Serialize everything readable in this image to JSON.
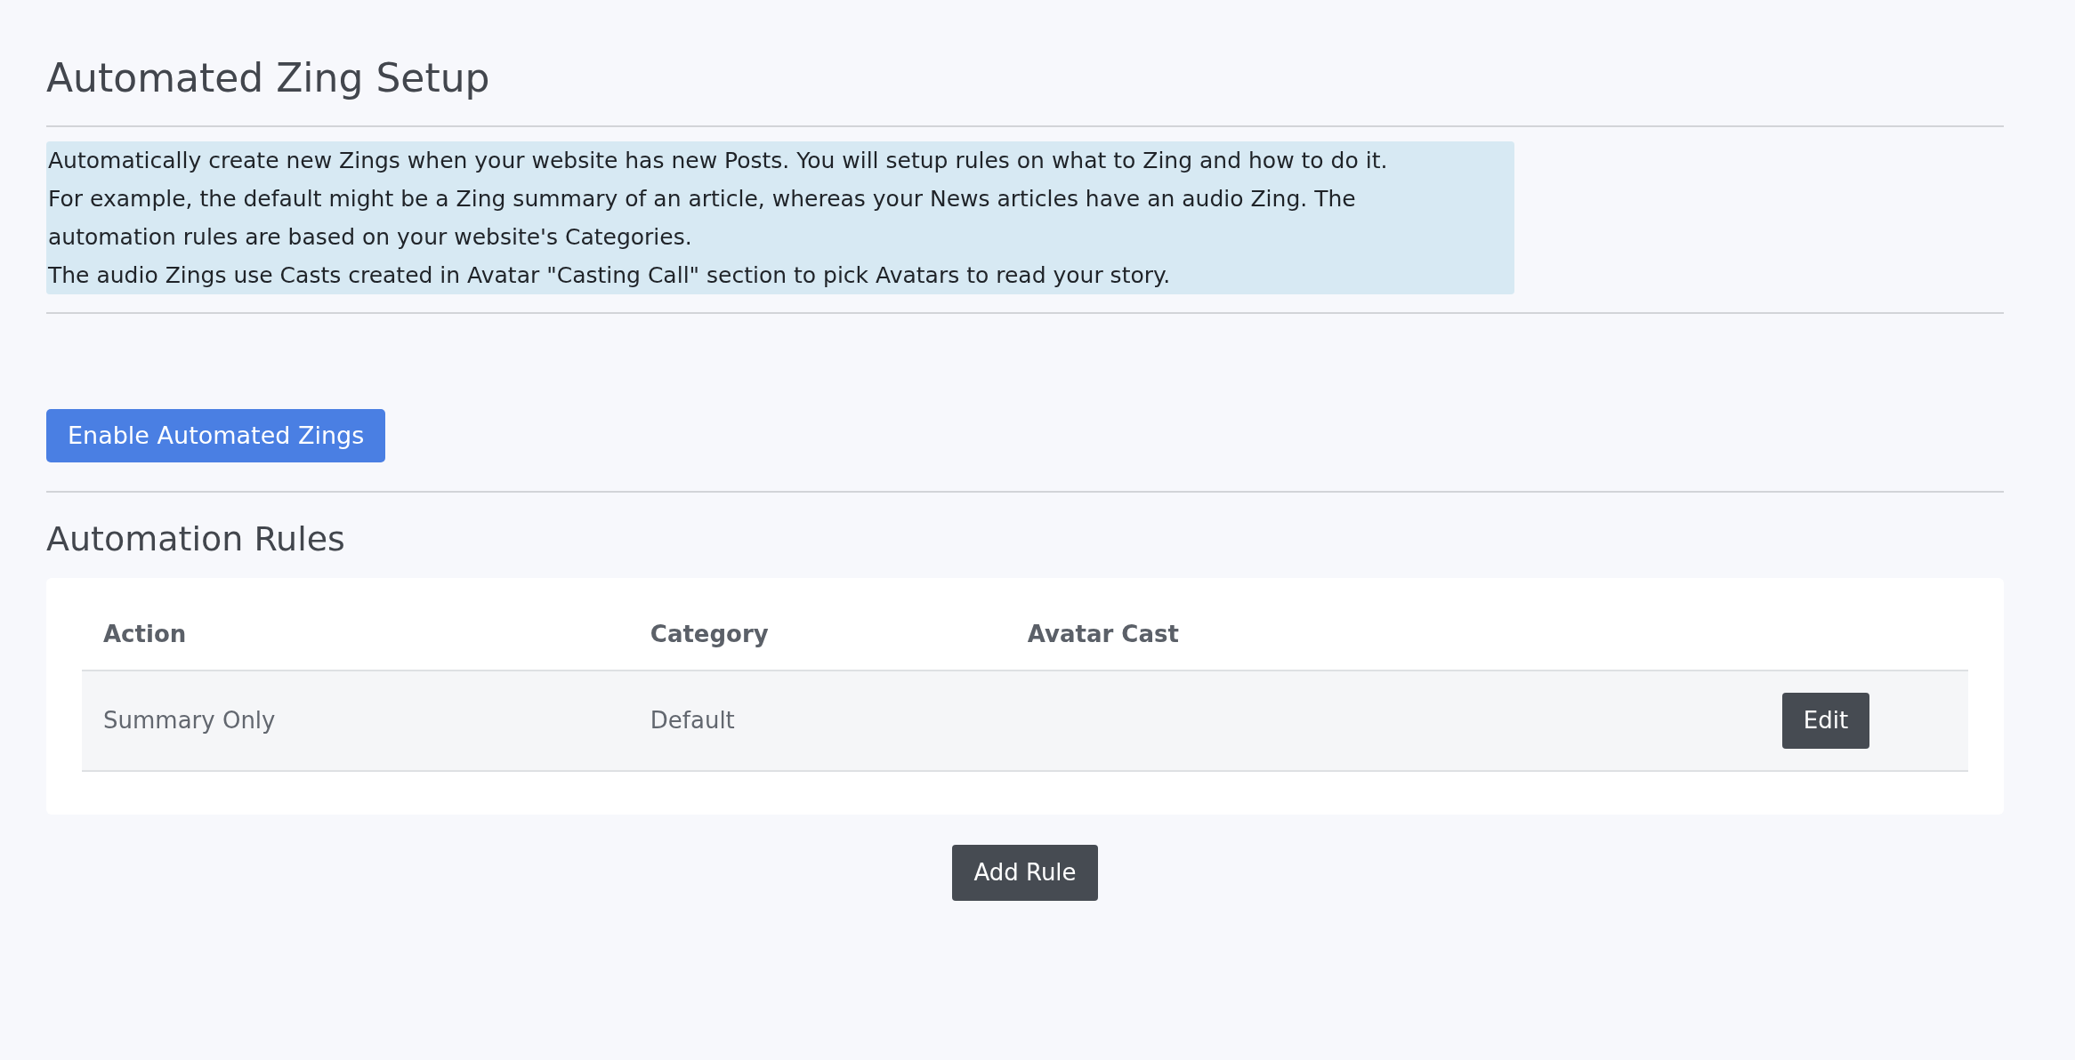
{
  "title": "Automated Zing Setup",
  "intro_lines": [
    "Automatically create new Zings when your website has new Posts. You will setup rules on what to Zing and how to do it.",
    "For example, the default might be a Zing summary of an article, whereas your News articles have an audio Zing. The",
    "automation rules are based on your website's Categories.",
    "The audio Zings use Casts created in Avatar \"Casting Call\" section to pick Avatars to read your story."
  ],
  "enable_button": "Enable Automated Zings",
  "rules_title": "Automation Rules",
  "table": {
    "columns": [
      "Action",
      "Category",
      "Avatar Cast"
    ],
    "rows": [
      {
        "action": "Summary Only",
        "category": "Default",
        "button": "Edit"
      }
    ]
  },
  "add_button": "Add Rule"
}
